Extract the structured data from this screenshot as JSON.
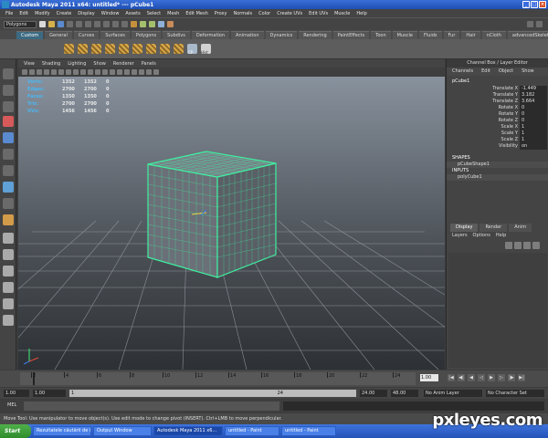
{
  "window": {
    "title": "Autodesk Maya 2011 x64: untitled*   ---   pCube1"
  },
  "menus": [
    "File",
    "Edit",
    "Modify",
    "Create",
    "Display",
    "Window",
    "Assets",
    "Select",
    "Mesh",
    "Edit Mesh",
    "Proxy",
    "Normals",
    "Color",
    "Create UVs",
    "Edit UVs",
    "Muscle",
    "Help"
  ],
  "status": {
    "mode": "Polygons"
  },
  "shelf": {
    "tabs": [
      "Custom",
      "General",
      "Curves",
      "Surfaces",
      "Polygons",
      "Subdivs",
      "Deformation",
      "Animation",
      "Dynamics",
      "Rendering",
      "PaintEffects",
      "Toon",
      "Muscle",
      "Fluids",
      "Fur",
      "Hair",
      "nCloth",
      "advancedSkeleton"
    ],
    "active_tab": 0,
    "labels": {
      "cp": "CP",
      "hist": "Hist"
    }
  },
  "viewport": {
    "menu": [
      "View",
      "Shading",
      "Lighting",
      "Show",
      "Renderer",
      "Panels"
    ],
    "hud": [
      {
        "label": "Verts:",
        "v1": "1352",
        "v2": "1352",
        "v3": "0"
      },
      {
        "label": "Edges:",
        "v1": "2700",
        "v2": "2700",
        "v3": "0"
      },
      {
        "label": "Faces:",
        "v1": "1350",
        "v2": "1350",
        "v3": "0"
      },
      {
        "label": "Tris:",
        "v1": "2700",
        "v2": "2700",
        "v3": "0"
      },
      {
        "label": "UVs:",
        "v1": "1456",
        "v2": "1456",
        "v3": "0"
      }
    ]
  },
  "channel_box": {
    "header": "Channel Box / Layer Editor",
    "menu": [
      "Channels",
      "Edit",
      "Object",
      "Show"
    ],
    "object": "pCube1",
    "attrs": [
      {
        "name": "Translate X",
        "value": "-1.449"
      },
      {
        "name": "Translate Y",
        "value": "3.182"
      },
      {
        "name": "Translate Z",
        "value": "3.664"
      },
      {
        "name": "Rotate X",
        "value": "0"
      },
      {
        "name": "Rotate Y",
        "value": "0"
      },
      {
        "name": "Rotate Z",
        "value": "0"
      },
      {
        "name": "Scale X",
        "value": "1"
      },
      {
        "name": "Scale Y",
        "value": "1"
      },
      {
        "name": "Scale Z",
        "value": "1"
      },
      {
        "name": "Visibility",
        "value": "on"
      }
    ],
    "shapes_label": "SHAPES",
    "shape": "pCubeShape1",
    "inputs_label": "INPUTS",
    "input": "polyCube1",
    "layer_tabs": [
      "Display",
      "Render",
      "Anim"
    ],
    "layer_menu": [
      "Layers",
      "Options",
      "Help"
    ]
  },
  "timeline": {
    "ticks": [
      "2",
      "4",
      "6",
      "8",
      "10",
      "12",
      "14",
      "16",
      "18",
      "20",
      "22",
      "24"
    ],
    "current_frame": "1.00"
  },
  "range": {
    "start": "1.00",
    "start2": "1.00",
    "bar_left": "1",
    "bar_right": "24",
    "end": "24.00",
    "end2": "48.00",
    "anim_layer": "No Anim Layer",
    "char_set": "No Character Set"
  },
  "command": {
    "label": "MEL"
  },
  "help_line": "Move Tool: Use manipulator to move object(s). Use edit mode to change pivot (INSERT). Ctrl+LMB to move perpendicular.",
  "taskbar": {
    "start": "Start",
    "items": [
      "Rezultatele căutării de in...",
      "Output Window",
      "Autodesk Maya 2011 x6...",
      "untitled - Paint",
      "untitled - Paint"
    ]
  },
  "watermark": "pxleyes.com",
  "colors": {
    "hud_label": "#4bb6f0",
    "wire": "#3ef0a0",
    "grid": "#9a9fa6"
  }
}
